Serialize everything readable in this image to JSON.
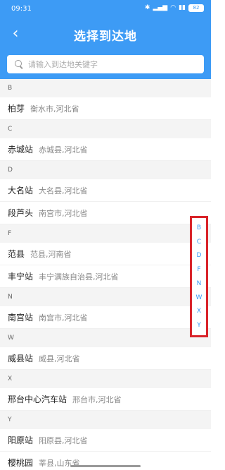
{
  "status_bar": {
    "time": "09:31",
    "icons": [
      "bluetooth-icon",
      "signal-icon",
      "wifi-icon",
      "mobile-data-icon"
    ],
    "battery": "82"
  },
  "header": {
    "back_icon": "chevron-left-icon",
    "title": "选择到达地",
    "background": "#3d9bf5"
  },
  "search": {
    "placeholder": "请输入到达地关键字",
    "value": ""
  },
  "sections": [
    {
      "letter": "B",
      "items": [
        {
          "name": "柏芽",
          "region": "衡水市,河北省"
        }
      ]
    },
    {
      "letter": "C",
      "items": [
        {
          "name": "赤城站",
          "region": "赤城县,河北省"
        }
      ]
    },
    {
      "letter": "D",
      "items": [
        {
          "name": "大名站",
          "region": "大名县,河北省"
        },
        {
          "name": "段芦头",
          "region": "南宫市,河北省"
        }
      ]
    },
    {
      "letter": "F",
      "items": [
        {
          "name": "范县",
          "region": "范县,河南省"
        },
        {
          "name": "丰宁站",
          "region": "丰宁满族自治县,河北省"
        }
      ]
    },
    {
      "letter": "N",
      "items": [
        {
          "name": "南宫站",
          "region": "南宫市,河北省"
        }
      ]
    },
    {
      "letter": "W",
      "items": [
        {
          "name": "威县站",
          "region": "威县,河北省"
        }
      ]
    },
    {
      "letter": "X",
      "items": [
        {
          "name": "邢台中心汽车站",
          "region": "邢台市,河北省"
        }
      ]
    },
    {
      "letter": "Y",
      "items": [
        {
          "name": "阳原站",
          "region": "阳原县,河北省"
        },
        {
          "name": "樱桃园",
          "region": "莘县,山东省"
        }
      ]
    }
  ],
  "index_letters": [
    "B",
    "C",
    "D",
    "F",
    "N",
    "W",
    "X",
    "Y"
  ],
  "colors": {
    "accent": "#3d9bf5",
    "highlight_border": "#d9242a"
  }
}
